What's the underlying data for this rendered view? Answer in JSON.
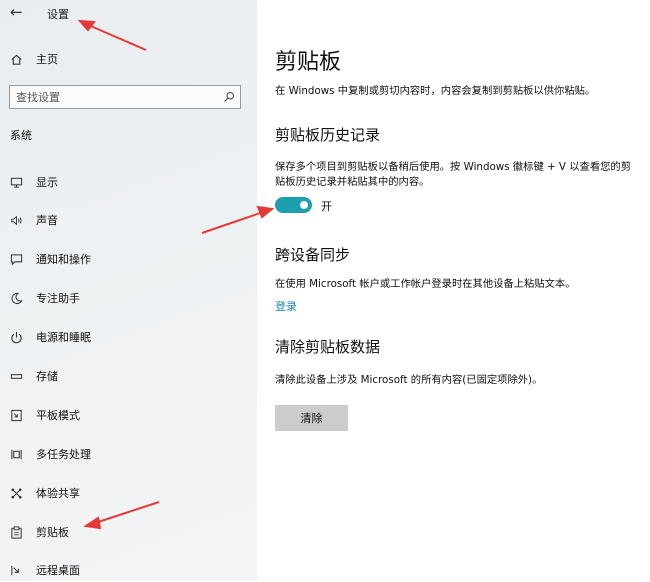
{
  "sidebar": {
    "back_glyph": "←",
    "title": "设置",
    "home": "主页",
    "search_placeholder": "查找设置",
    "section_label": "系统",
    "items": [
      {
        "label": "显示",
        "icon": "monitor-icon"
      },
      {
        "label": "声音",
        "icon": "speaker-icon"
      },
      {
        "label": "通知和操作",
        "icon": "message-icon"
      },
      {
        "label": "专注助手",
        "icon": "moon-icon"
      },
      {
        "label": "电源和睡眠",
        "icon": "power-icon"
      },
      {
        "label": "存储",
        "icon": "storage-icon"
      },
      {
        "label": "平板模式",
        "icon": "tablet-icon"
      },
      {
        "label": "多任务处理",
        "icon": "multitask-icon"
      },
      {
        "label": "体验共享",
        "icon": "share-icon"
      },
      {
        "label": "剪贴板",
        "icon": "clipboard-icon"
      },
      {
        "label": "远程桌面",
        "icon": "remote-icon"
      }
    ]
  },
  "main": {
    "title": "剪贴板",
    "intro": "在 Windows 中复制或剪切内容时，内容会复制到剪贴板以供你粘贴。",
    "history": {
      "heading": "剪贴板历史记录",
      "desc": "保存多个项目到剪贴板以备稍后使用。按 Windows 徽标键 + V 以查看您的剪贴板历史记录并粘贴其中的内容。",
      "toggle_state": "开"
    },
    "sync": {
      "heading": "跨设备同步",
      "desc": "在使用 Microsoft 帐户或工作帐户登录时在其他设备上粘贴文本。",
      "link": "登录"
    },
    "clear": {
      "heading": "清除剪贴板数据",
      "desc": "清除此设备上涉及 Microsoft 的所有内容(已固定项除外)。",
      "button": "清除"
    }
  },
  "colors": {
    "toggle_on": "#1e9fb0",
    "link": "#1a7fc1",
    "annotation_arrow": "#e53935"
  }
}
